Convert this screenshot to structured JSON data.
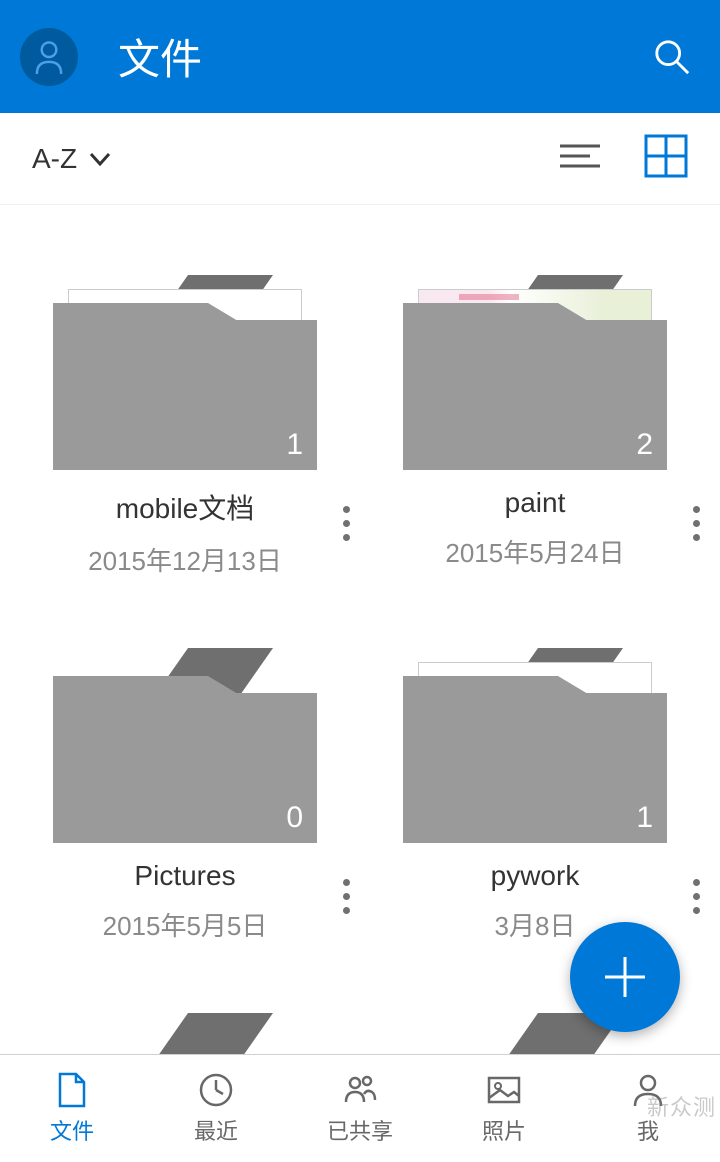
{
  "header": {
    "title": "文件"
  },
  "toolbar": {
    "sort_label": "A-Z"
  },
  "folders": [
    {
      "name": "mobile文档",
      "date": "2015年12月13日",
      "count": "1",
      "paper": "plain"
    },
    {
      "name": "paint",
      "date": "2015年5月24日",
      "count": "2",
      "paper": "colored"
    },
    {
      "name": "Pictures",
      "date": "2015年5月5日",
      "count": "0",
      "paper": "none"
    },
    {
      "name": "pywork",
      "date": "3月8日",
      "count": "1",
      "paper": "plain"
    }
  ],
  "nav": {
    "files": "文件",
    "recent": "最近",
    "shared": "已共享",
    "photos": "照片",
    "me": "我"
  },
  "watermark": "新众测"
}
